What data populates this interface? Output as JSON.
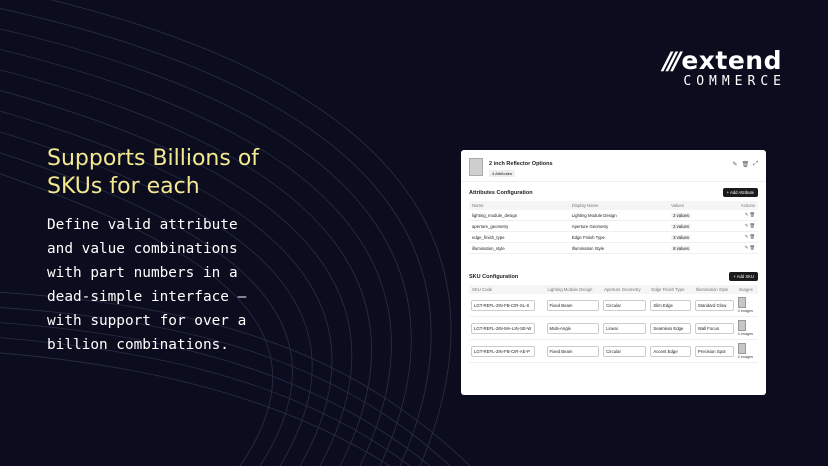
{
  "logo": {
    "slashes": "///",
    "word": "extend",
    "sub": "COMMERCE"
  },
  "headline": "Supports Billions of SKUs for each",
  "body": "Define valid attribute\nand value combinations\nwith part numbers in a\ndead-simple interface –\nwith support for over a\nbillion combinations.",
  "panel": {
    "option_title": "2 inch Reflector Options",
    "option_badge": "4 Attributes",
    "attributes_title": "Attributes Configuration",
    "add_attribute": "+ Add Attribute",
    "attr_headers": [
      "Name",
      "Display Name",
      "Values",
      "Actions"
    ],
    "attributes": [
      {
        "name": "lighting_module_design",
        "display": "Lighting Module Design",
        "values": "2 values"
      },
      {
        "name": "aperture_geometry",
        "display": "Aperture Geometry",
        "values": "2 values"
      },
      {
        "name": "edge_finish_type",
        "display": "Edge Finish Type",
        "values": "3 values"
      },
      {
        "name": "illumination_style",
        "display": "Illumination Style",
        "values": "8 values"
      }
    ],
    "sku_title": "SKU Configuration",
    "add_sku": "+ Add SKU",
    "sku_headers": [
      "SKU Code",
      "Lighting Module Design",
      "Aperture Geometry",
      "Edge Finish Type",
      "Illumination Style",
      "Images"
    ],
    "skus": [
      {
        "code": "LGT-REFL-2IN-FB-CIR-SL-S",
        "design": "Fixed Beam",
        "aperture": "Circular",
        "edge": "Slim Edge",
        "style": "Standard Glow",
        "images": "4 images"
      },
      {
        "code": "LGT-REFL-2IN-MA-LIN-SE-W",
        "design": "Multi-Angle",
        "aperture": "Linear",
        "edge": "Seamless Edge",
        "style": "Wall Focus",
        "images": "4 images"
      },
      {
        "code": "LGT-REFL-2IN-FB-CIR-AE-P",
        "design": "Fixed Beam",
        "aperture": "Circular",
        "edge": "Accent Edge",
        "style": "Precision Spot",
        "images": "4 images"
      }
    ]
  }
}
